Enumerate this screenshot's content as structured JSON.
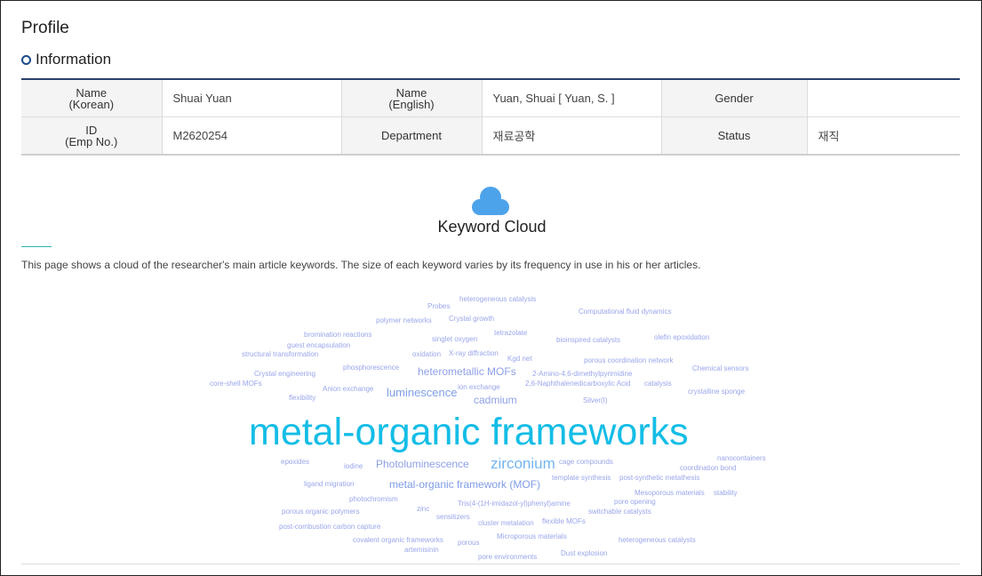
{
  "profile_title": "Profile",
  "section_title": "Information",
  "info": {
    "name_korean_label": "Name\n(Korean)",
    "name_korean_value": "Shuai Yuan",
    "name_english_label": "Name\n(English)",
    "name_english_value": "Yuan, Shuai [ Yuan, S. ]",
    "gender_label": "Gender",
    "gender_value": "",
    "id_label": "ID\n(Emp No.)",
    "id_value": "M2620254",
    "department_label": "Department",
    "department_value": "재료공학",
    "status_label": "Status",
    "status_value": "재직"
  },
  "keyword_cloud": {
    "icon": "cloud-icon",
    "title": "Keyword Cloud",
    "description": "This page shows a cloud of the researcher's main article keywords. The size of each keyword varies by its frequency in use in his or her articles.",
    "accent_color": "#2eb5b5",
    "keywords": [
      "heterogeneous catalysis",
      "Probes",
      "Computational fluid dynamics",
      "polymer networks",
      "Crystal growth",
      "bromination reactions",
      "tetrazolate",
      "singlet oxygen",
      "bioinspired catalysts",
      "olefin epoxidation",
      "guest encapsulation",
      "Kgd net",
      "X-ray diffraction",
      "oxidation",
      "structural transformation",
      "porous coordination network",
      "phosphorescence",
      "heterometallic MOFs",
      "2-Amino-4,6-dimethylpyrimidine",
      "Chemical sensors",
      "Crystal engineering",
      "2,6-Naphthalenedicarboxylic Acid",
      "catalysis",
      "core-shell MOFs",
      "Anion exchange",
      "ion exchange",
      "crystalline sponge",
      "luminescence",
      "flexibility",
      "cadmium",
      "Silver(I)",
      "metal-organic frameworks",
      "nanocontainers",
      "epoxides",
      "iodine",
      "Photoluminescence",
      "zirconium",
      "cage compounds",
      "coordination bond",
      "ligand migration",
      "metal-organic framework (MOF)",
      "template synthesis",
      "post-synthetic metathesis",
      "Mesoporous materials",
      "stability",
      "photochromism",
      "pore opening",
      "Tris(4-(1H-imidazol-yl)phenyl)amine",
      "zinc",
      "switchable catalysts",
      "porous organic polymers",
      "sensitizers",
      "flexible MOFs",
      "cluster metalation",
      "post-combustion carbon capture",
      "Microporous materials",
      "covalent organic frameworks",
      "porous",
      "heterogeneous catalysts",
      "artemisinin",
      "Dust explosion",
      "pore environments"
    ]
  }
}
